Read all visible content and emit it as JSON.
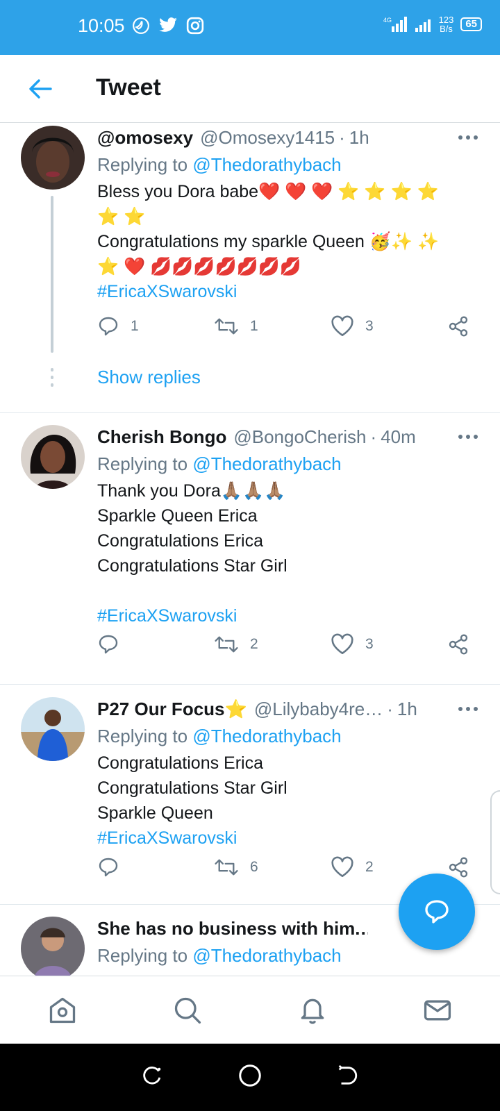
{
  "status_bar": {
    "time": "10:05",
    "net_speed_value": "123",
    "net_speed_unit": "B/s",
    "battery": "65",
    "signal_label": "4G"
  },
  "header": {
    "title": "Tweet"
  },
  "tweets": [
    {
      "name": "@omosexy",
      "handle": "@Omosexy1415",
      "time": "1h",
      "replying_prefix": "Replying to",
      "replying_to": "@Thedorathybach",
      "line1": "Bless you Dora babe❤️ ❤️ ❤️ ⭐ ⭐ ⭐ ⭐",
      "line2": "⭐ ⭐",
      "line3": "Congratulations my sparkle Queen 🥳✨ ✨",
      "line4": "⭐ ❤️ 💋💋💋💋💋💋💋",
      "hashtag": "#EricaXSwarovski",
      "replies": "1",
      "retweets": "1",
      "likes": "3"
    },
    {
      "name": "Cherish Bongo",
      "handle": "@BongoCherish",
      "time": "40m",
      "replying_prefix": "Replying to",
      "replying_to": "@Thedorathybach",
      "line1": "Thank you Dora🙏🏽🙏🏽🙏🏽",
      "line2": "Sparkle Queen Erica",
      "line3": "Congratulations Erica",
      "line4": "Congratulations Star Girl",
      "hashtag": "#EricaXSwarovski",
      "replies": "",
      "retweets": "2",
      "likes": "3"
    },
    {
      "name": "P27 Our Focus⭐",
      "handle": "@Lilybaby4re…",
      "time": "1h",
      "replying_prefix": "Replying to",
      "replying_to": "@Thedorathybach",
      "line1": "Congratulations Erica",
      "line2": "Congratulations Star Girl",
      "line3": "Sparkle Queen",
      "hashtag": "#EricaXSwarovski",
      "replies": "",
      "retweets": "6",
      "likes": "2"
    },
    {
      "name": "She has no business with him.…",
      "replying_prefix": "Replying to",
      "replying_to": "@Thedorathybach"
    }
  ],
  "show_replies": "Show replies",
  "colors": {
    "status_bar": "#2ea2e8",
    "accent": "#1da1f2",
    "secondary_text": "#657786"
  }
}
